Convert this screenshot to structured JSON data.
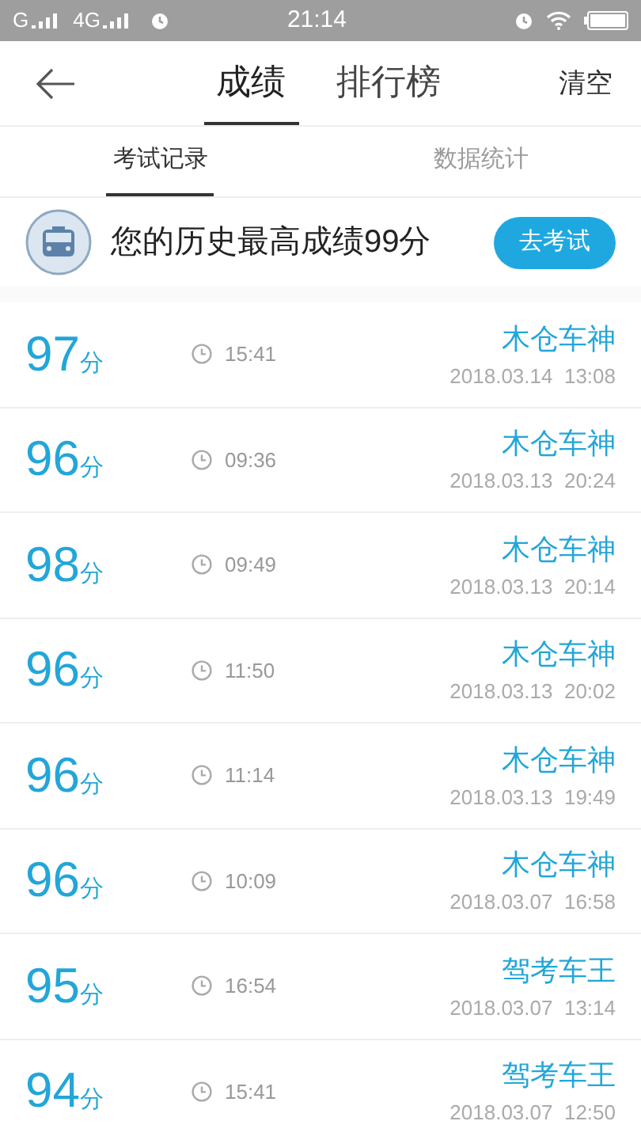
{
  "status_bar": {
    "carrier_1": "G",
    "carrier_2": "4G",
    "time": "21:14"
  },
  "header": {
    "tabs": [
      {
        "label": "成绩",
        "selected": true
      },
      {
        "label": "排行榜",
        "selected": false
      }
    ],
    "action": "清空"
  },
  "sub_tabs": [
    {
      "label": "考试记录",
      "selected": true
    },
    {
      "label": "数据统计",
      "selected": false
    }
  ],
  "banner": {
    "text": "您的历史最高成绩99分",
    "button": "去考试"
  },
  "records": [
    {
      "score": "97",
      "unit": "分",
      "duration": "15:41",
      "title": "木仓车神",
      "date": "2018.03.14  13:08"
    },
    {
      "score": "96",
      "unit": "分",
      "duration": "09:36",
      "title": "木仓车神",
      "date": "2018.03.13  20:24"
    },
    {
      "score": "98",
      "unit": "分",
      "duration": "09:49",
      "title": "木仓车神",
      "date": "2018.03.13  20:14"
    },
    {
      "score": "96",
      "unit": "分",
      "duration": "11:50",
      "title": "木仓车神",
      "date": "2018.03.13  20:02"
    },
    {
      "score": "96",
      "unit": "分",
      "duration": "11:14",
      "title": "木仓车神",
      "date": "2018.03.13  19:49"
    },
    {
      "score": "96",
      "unit": "分",
      "duration": "10:09",
      "title": "木仓车神",
      "date": "2018.03.07  16:58"
    },
    {
      "score": "95",
      "unit": "分",
      "duration": "16:54",
      "title": "驾考车王",
      "date": "2018.03.07  13:14"
    },
    {
      "score": "94",
      "unit": "分",
      "duration": "15:41",
      "title": "驾考车王",
      "date": "2018.03.07  12:50"
    }
  ]
}
